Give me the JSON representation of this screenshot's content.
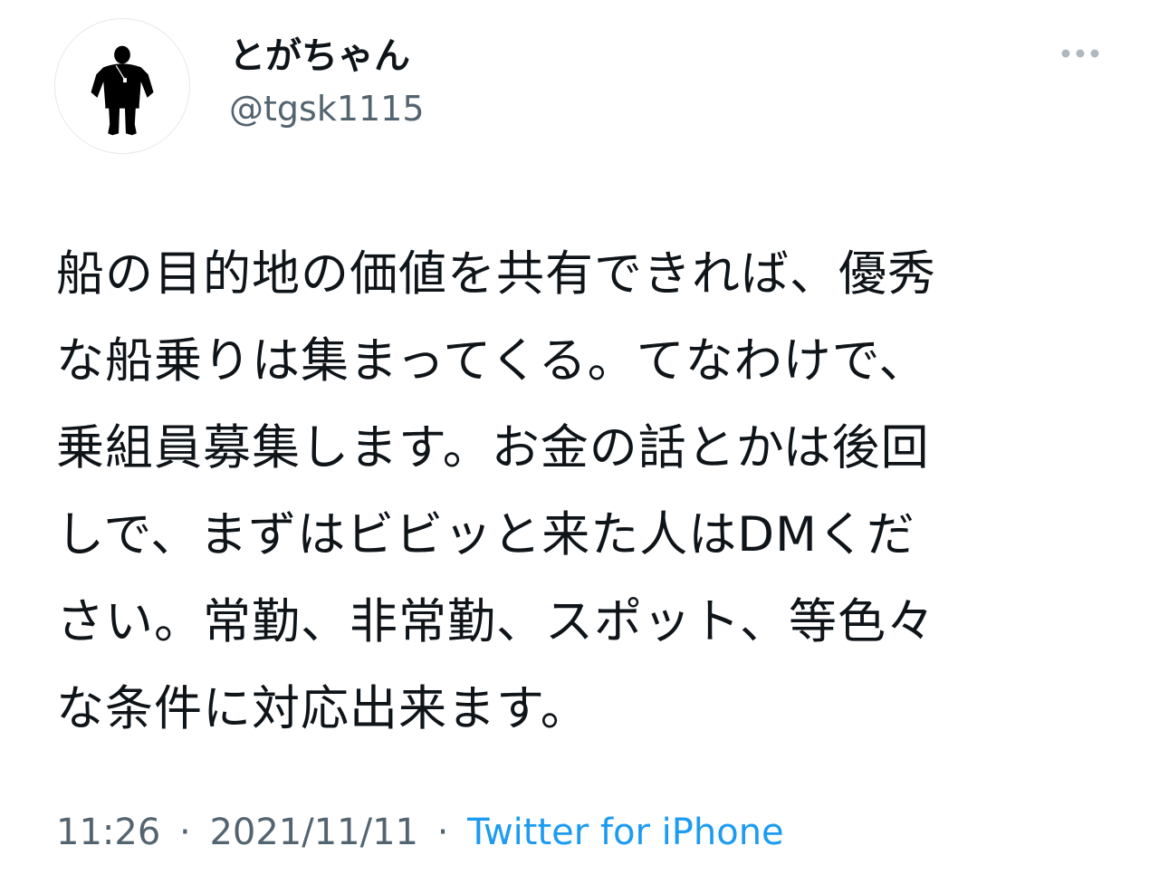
{
  "author": {
    "display_name": "とがちゃん",
    "handle": "@tgsk1115",
    "avatar_icon": "silhouette-person-icon"
  },
  "menu": {
    "more_icon": "more-dots-icon"
  },
  "tweet": {
    "text_lines": [
      "船の目的地の価値を共有できれば、優秀",
      "な船乗りは集まってくる。てなわけで、",
      "乗組員募集します。お金の話とかは後回",
      "しで、まずはビビッと来た人はDMくだ",
      "さい。常勤、非常勤、スポット、等色々",
      "な条件に対応出来ます。"
    ]
  },
  "meta": {
    "time": "11:26",
    "separator": "·",
    "date": "2021/11/11",
    "source": "Twitter for iPhone"
  },
  "colors": {
    "text": "#0f1419",
    "secondary": "#536471",
    "link": "#1d9bf0"
  }
}
